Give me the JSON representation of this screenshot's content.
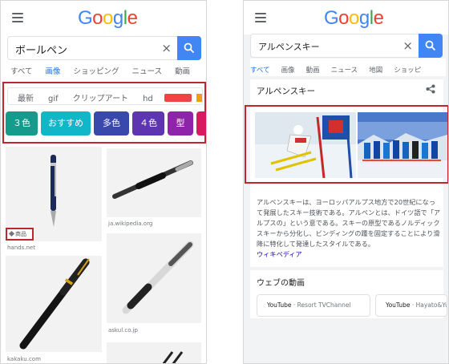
{
  "left": {
    "logo": [
      "G",
      "o",
      "o",
      "g",
      "l",
      "e"
    ],
    "search_query": "ボールペン",
    "clear_icon": "×",
    "tabs": [
      "すべて",
      "画像",
      "ショッピング",
      "ニュース",
      "動画"
    ],
    "filters": [
      "最新",
      "gif",
      "クリップアート",
      "hd"
    ],
    "chips": [
      {
        "label": "３色",
        "color": "#159a8c"
      },
      {
        "label": "おすすめ",
        "color": "#12b6c9"
      },
      {
        "label": "多色",
        "color": "#3949ab"
      },
      {
        "label": "４色",
        "color": "#5e35b1"
      },
      {
        "label": "型",
        "color": "#8e24aa"
      },
      {
        "label": "",
        "color": "#d81b60"
      }
    ],
    "badge": "商品",
    "captions": [
      "hands.net",
      "ja.wikipedia.org",
      "kakaku.com",
      "askul.co.jp"
    ]
  },
  "right": {
    "logo": [
      "G",
      "o",
      "o",
      "g",
      "l",
      "e"
    ],
    "search_query": "アルペンスキー",
    "clear_icon": "×",
    "tabs": [
      "すべて",
      "画像",
      "動画",
      "ニュース",
      "地図",
      "ショッピ"
    ],
    "kp_title": "アルペンスキー",
    "description": "アルペンスキーは、ヨーロッパアルプス地方で20世紀になって発展したスキー技術である。アルペンとは、ドイツ語で「アルプスの」という意である。スキーの原型であるノルディックスキーから分化し、ビンディングの踵を固定することにより滑降に特化して発達したスタイルである。",
    "wiki": "ウィキペディア",
    "video_section": "ウェブの動画",
    "videos": [
      {
        "source": "YouTube",
        "channel": "Resort TVChannel"
      },
      {
        "source": "YouTube",
        "channel": "Hayato&Yu"
      }
    ]
  }
}
